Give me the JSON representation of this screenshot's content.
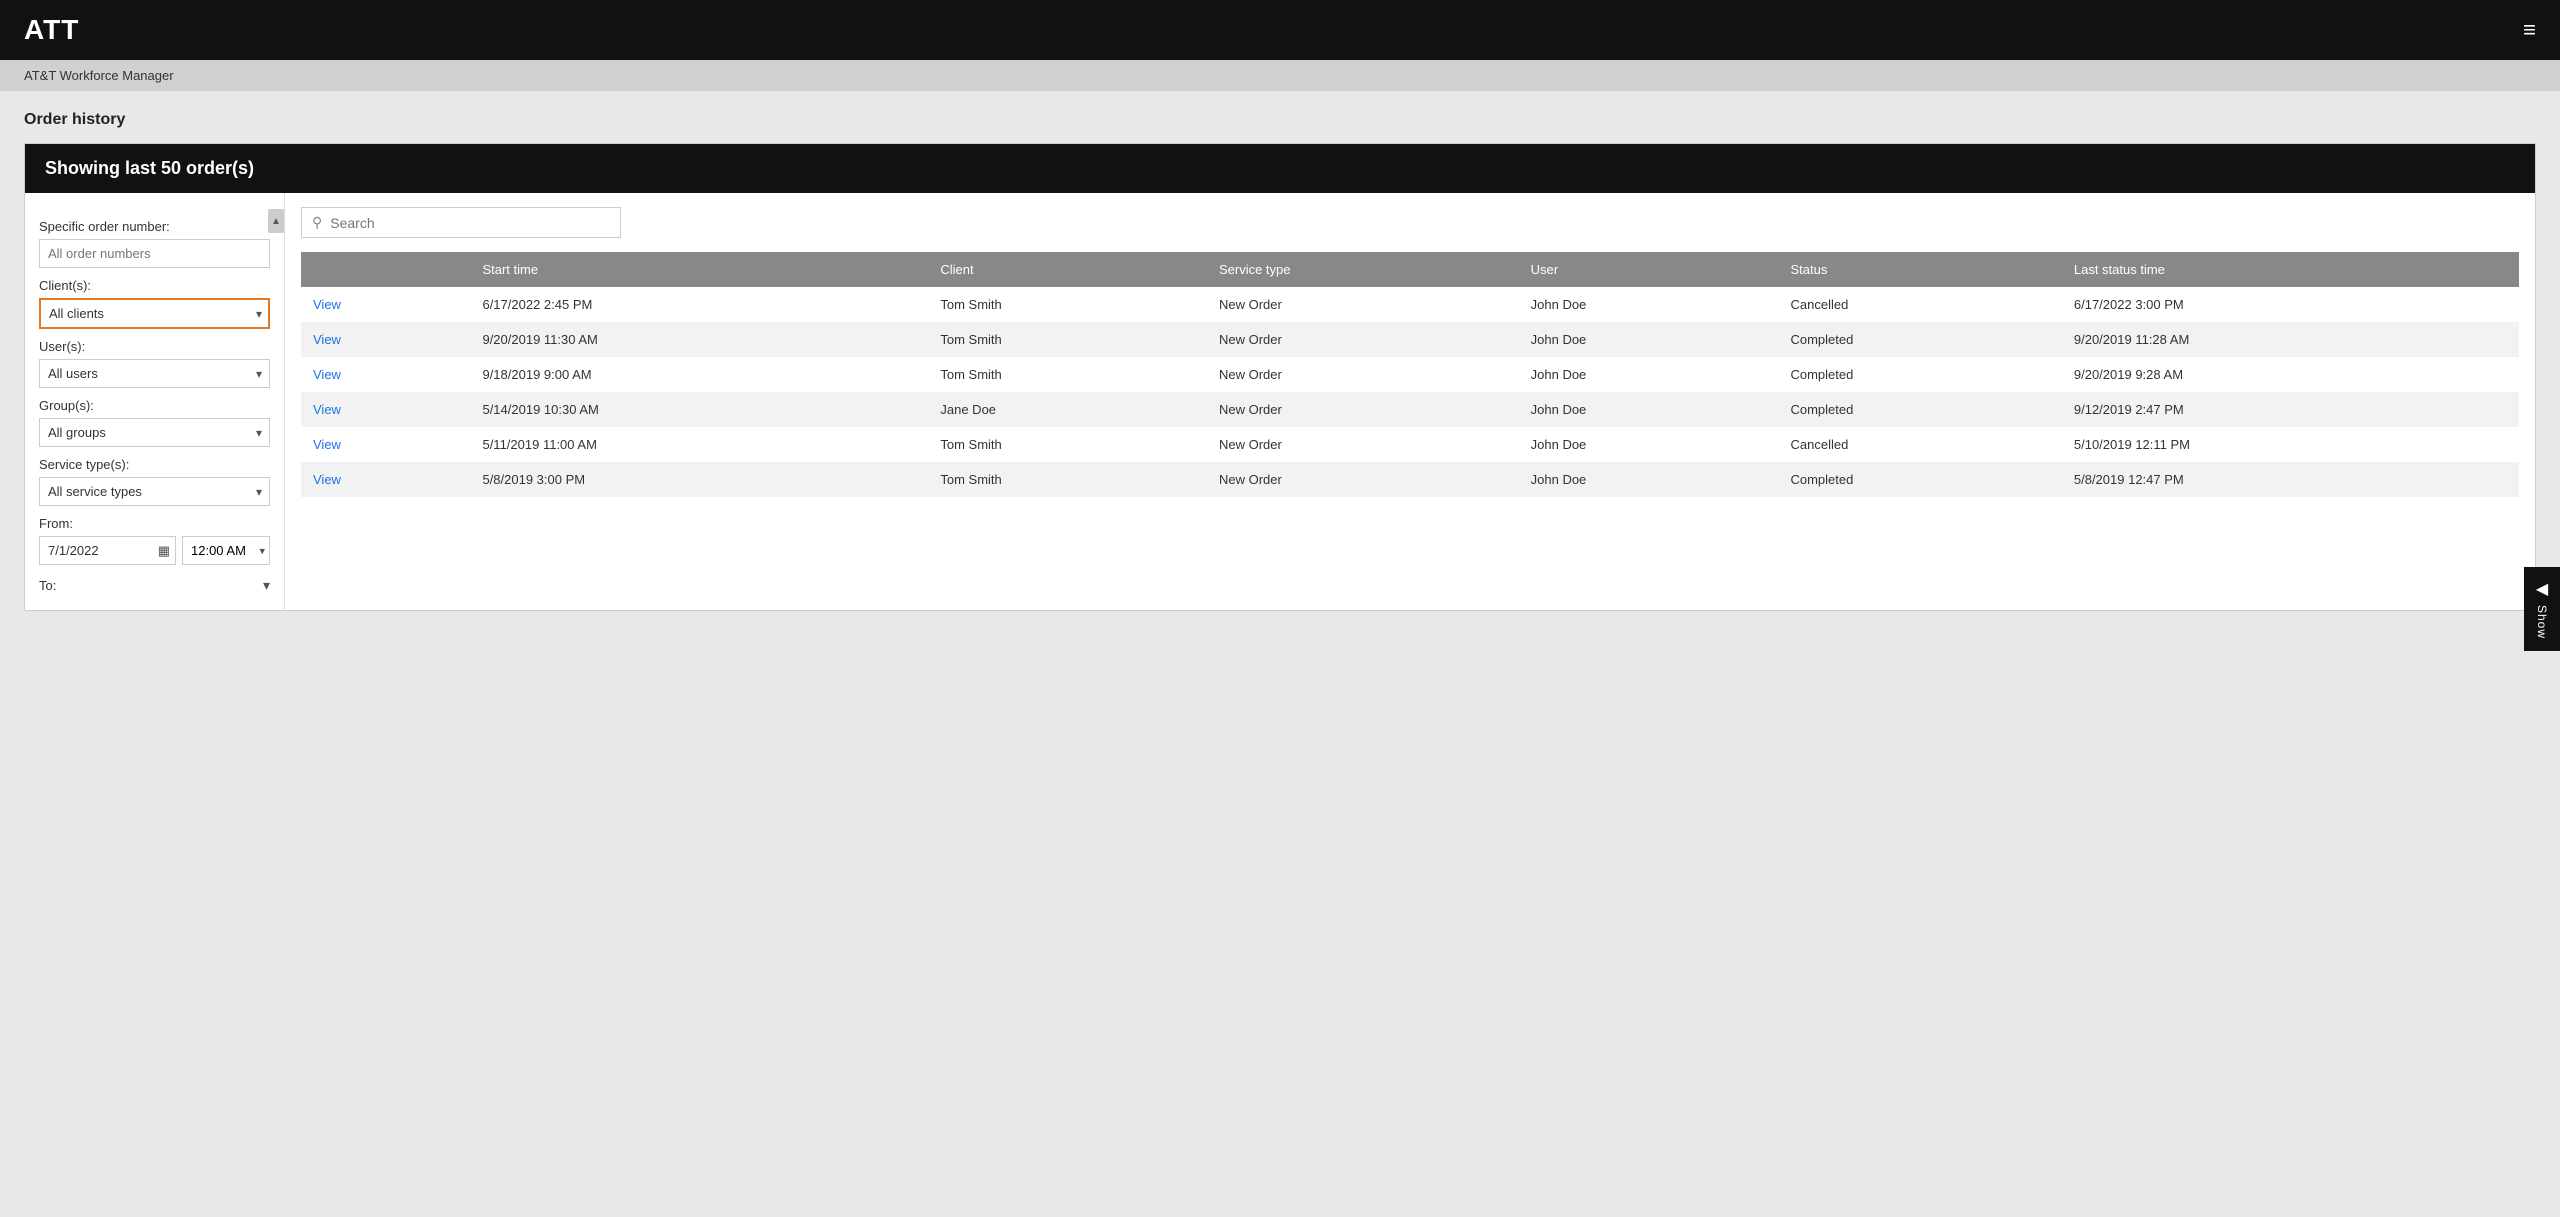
{
  "app": {
    "logo": "ATT",
    "menu_icon": "≡",
    "subtitle": "AT&T Workforce Manager"
  },
  "page": {
    "title": "Order history",
    "card_header": "Showing last 50 order(s)"
  },
  "filters": {
    "specific_order_label": "Specific order number:",
    "specific_order_placeholder": "All order numbers",
    "clients_label": "Client(s):",
    "clients_value": "All clients",
    "users_label": "User(s):",
    "users_value": "All users",
    "groups_label": "Group(s):",
    "groups_value": "All groups",
    "service_type_label": "Service type(s):",
    "service_type_value": "All service types",
    "from_label": "From:",
    "from_date": "7/1/2022",
    "from_time": "12:00 AM",
    "to_label": "To:"
  },
  "search": {
    "placeholder": "Search"
  },
  "table": {
    "columns": [
      "",
      "Start time",
      "Client",
      "Service type",
      "User",
      "Status",
      "Last status time"
    ],
    "rows": [
      {
        "action": "View",
        "start_time": "6/17/2022 2:45 PM",
        "client": "Tom Smith",
        "service_type": "New Order",
        "user": "John Doe",
        "status": "Cancelled",
        "last_status_time": "6/17/2022 3:00 PM"
      },
      {
        "action": "View",
        "start_time": "9/20/2019 11:30 AM",
        "client": "Tom Smith",
        "service_type": "New Order",
        "user": "John Doe",
        "status": "Completed",
        "last_status_time": "9/20/2019 11:28 AM"
      },
      {
        "action": "View",
        "start_time": "9/18/2019 9:00 AM",
        "client": "Tom Smith",
        "service_type": "New Order",
        "user": "John Doe",
        "status": "Completed",
        "last_status_time": "9/20/2019 9:28 AM"
      },
      {
        "action": "View",
        "start_time": "5/14/2019 10:30 AM",
        "client": "Jane Doe",
        "service_type": "New Order",
        "user": "John Doe",
        "status": "Completed",
        "last_status_time": "9/12/2019 2:47 PM"
      },
      {
        "action": "View",
        "start_time": "5/11/2019 11:00 AM",
        "client": "Tom Smith",
        "service_type": "New Order",
        "user": "John Doe",
        "status": "Cancelled",
        "last_status_time": "5/10/2019 12:11 PM"
      },
      {
        "action": "View",
        "start_time": "5/8/2019 3:00 PM",
        "client": "Tom Smith",
        "service_type": "New Order",
        "user": "John Doe",
        "status": "Completed",
        "last_status_time": "5/8/2019 12:47 PM"
      }
    ]
  },
  "side_panel": {
    "arrow": "◀",
    "label": "Show"
  }
}
